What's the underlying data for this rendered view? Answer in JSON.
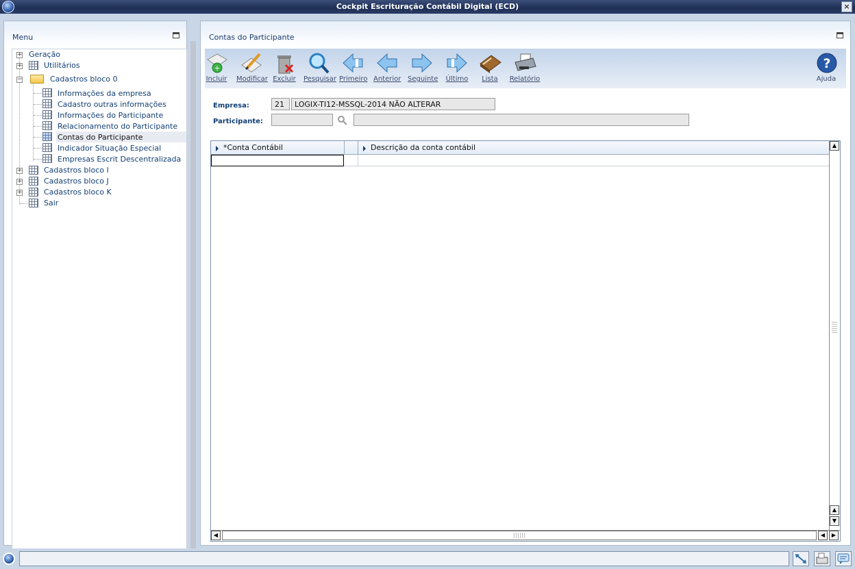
{
  "window": {
    "title": "Cockpit Escrituração Contábil Digital (ECD)",
    "close_label": "×"
  },
  "menu": {
    "title": "Menu",
    "items": [
      {
        "label": "Geração"
      },
      {
        "label": "Utilitários"
      },
      {
        "label": "Cadastros bloco 0"
      },
      {
        "label": "Informações da empresa"
      },
      {
        "label": "Cadastro outras informações"
      },
      {
        "label": "Informações do Participante"
      },
      {
        "label": "Relacionamento do Participante"
      },
      {
        "label": "Contas do Participante"
      },
      {
        "label": "Indicador Situação Especial"
      },
      {
        "label": "Empresas Escrit Descentralizada"
      },
      {
        "label": "Cadastros bloco I"
      },
      {
        "label": "Cadastros bloco J"
      },
      {
        "label": "Cadastros bloco K"
      },
      {
        "label": "Sair"
      }
    ]
  },
  "main": {
    "title": "Contas do Participante",
    "toolbar": [
      {
        "label": "Incluir",
        "icon": "add-document-icon"
      },
      {
        "label": "Modificar",
        "icon": "edit-pencil-icon"
      },
      {
        "label": "Excluir",
        "icon": "trash-icon"
      },
      {
        "label": "Pesquisar",
        "icon": "magnifier-icon"
      },
      {
        "label": "Primeiro",
        "icon": "first-arrow-icon"
      },
      {
        "label": "Anterior",
        "icon": "previous-arrow-icon"
      },
      {
        "label": "Seguinte",
        "icon": "next-arrow-icon"
      },
      {
        "label": "Último",
        "icon": "last-arrow-icon"
      },
      {
        "label": "Lista",
        "icon": "book-icon"
      },
      {
        "label": "Relatório",
        "icon": "printer-icon"
      },
      {
        "label": "Ajuda",
        "icon": "help-icon"
      }
    ],
    "form": {
      "empresa_label": "Empresa:",
      "empresa_code": "21",
      "empresa_name": "LOGIX-TI12-MSSQL-2014 NÃO ALTERAR",
      "participante_label": "Participante:",
      "participante_code": "",
      "participante_name": ""
    },
    "grid": {
      "columns": [
        "*Conta Contábil",
        "Descrição da conta contábil"
      ],
      "rows": [
        [
          "",
          ""
        ]
      ]
    }
  },
  "status": {
    "text": ""
  }
}
